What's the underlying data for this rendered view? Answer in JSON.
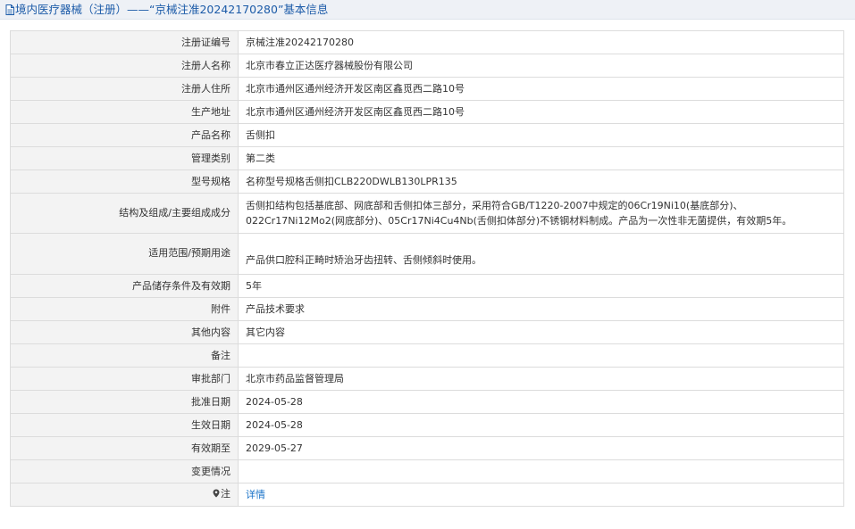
{
  "page": {
    "title": "境内医疗器械（注册）——“京械注准20242170280”基本信息"
  },
  "rows": [
    {
      "label": "注册证编号",
      "value": "京械注准20242170280"
    },
    {
      "label": "注册人名称",
      "value": "北京市春立正达医疗器械股份有限公司"
    },
    {
      "label": "注册人住所",
      "value": "北京市通州区通州经济开发区南区鑫觅西二路10号"
    },
    {
      "label": "生产地址",
      "value": "北京市通州区通州经济开发区南区鑫觅西二路10号"
    },
    {
      "label": "产品名称",
      "value": "舌侧扣"
    },
    {
      "label": "管理类别",
      "value": "第二类"
    },
    {
      "label": "型号规格",
      "value": "名称型号规格舌侧扣CLB220DWLB130LPR135"
    },
    {
      "label": "结构及组成/主要组成成分",
      "value": "舌侧扣结构包括基底部、网底部和舌侧扣体三部分，采用符合GB/T1220-2007中规定的06Cr19Ni10(基底部分)、022Cr17Ni12Mo2(网底部分)、05Cr17Ni4Cu4Nb(舌侧扣体部分)不锈钢材料制成。产品为一次性非无菌提供，有效期5年。"
    },
    {
      "label": "适用范围/预期用途",
      "value": "产品供口腔科正畸时矫治牙齿扭转、舌侧倾斜时使用。"
    },
    {
      "label": "产品储存条件及有效期",
      "value": "5年"
    },
    {
      "label": "附件",
      "value": "产品技术要求"
    },
    {
      "label": "其他内容",
      "value": "其它内容"
    },
    {
      "label": "备注",
      "value": ""
    },
    {
      "label": "审批部门",
      "value": "北京市药品监督管理局"
    },
    {
      "label": "批准日期",
      "value": "2024-05-28"
    },
    {
      "label": "生效日期",
      "value": "2024-05-28"
    },
    {
      "label": "有效期至",
      "value": "2029-05-27"
    },
    {
      "label": "变更情况",
      "value": ""
    }
  ],
  "note": {
    "icon": "map-pin-icon",
    "label": "注",
    "link_text": "详情"
  },
  "colors": {
    "title": "#1c5ba8",
    "link": "#1a73c8",
    "label_bg": "#f3f3f3",
    "header_bg": "#eef1f6",
    "border": "#dcdcdc"
  }
}
